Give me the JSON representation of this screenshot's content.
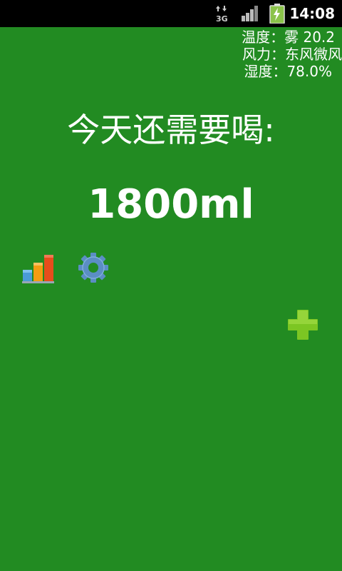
{
  "status_bar": {
    "network_label": "3G",
    "time": "14:08"
  },
  "weather": {
    "line1": "温度：雾 20.2",
    "line2": "风力：东风微风",
    "line3": "湿度：78.0%"
  },
  "main": {
    "headline": "今天还需要喝:",
    "amount": "1800ml"
  },
  "icons": {
    "stats": "bar-chart-icon",
    "settings": "gear-icon",
    "add": "plus-icon"
  },
  "colors": {
    "background": "#228B22",
    "status_bar": "#000000",
    "text": "#ffffff",
    "plus": "#7CC623",
    "gear": "#5B8EC4",
    "bar1": "#4A9BD6",
    "bar2": "#F39C12",
    "bar3": "#E74C1C",
    "battery": "#8BC34A"
  }
}
